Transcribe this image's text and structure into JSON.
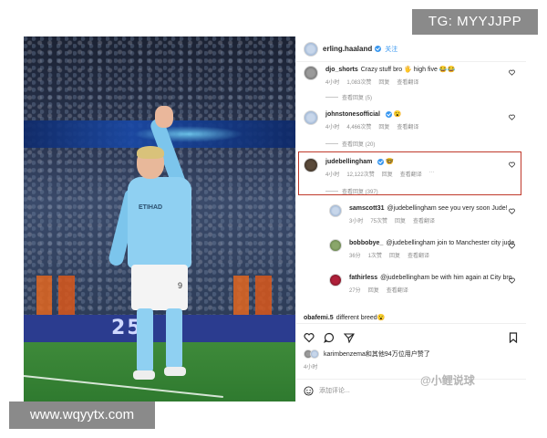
{
  "overlays": {
    "top_right": "TG: MYYJJPP",
    "bottom_left": "www.wqyytx.com",
    "watermark": "@小鲤说球"
  },
  "photo": {
    "ad_board_text": "25",
    "shirt_badge": "ETIHAD",
    "shorts_number": "9"
  },
  "post": {
    "username": "erling.haaland",
    "follow": "关注",
    "likes_text": "karimbenzema和其他94万位用户赞了",
    "time": "4小时",
    "comment_placeholder": "添加评论..."
  },
  "comments": [
    {
      "user": "djo_shorts",
      "text": "Crazy stuff bro 🖐 high five 😂😂",
      "time": "4小时",
      "likes": "1,083次赞",
      "reply": "回复",
      "translate": "查看翻译",
      "replies": "查看回复 (5)"
    },
    {
      "user": "johnstonesofficial",
      "text": "😮",
      "time": "4小时",
      "likes": "4,466次赞",
      "reply": "回复",
      "translate": "查看翻译",
      "replies": "查看回复 (20)"
    },
    {
      "user": "judebellingham",
      "text": "🤓",
      "time": "4小时",
      "likes": "12,122次赞",
      "reply": "回复",
      "translate": "查看翻译",
      "more": "···",
      "replies": "查看回复 (397)"
    }
  ],
  "replies": [
    {
      "user": "samscott31",
      "text": "@judebellingham see you very soon Jude!",
      "time": "3小时",
      "likes": "75次赞",
      "reply": "回复",
      "translate": "查看翻译"
    },
    {
      "user": "bobbobye_",
      "text": "@judebellingham join to Manchester city jude",
      "time": "36分",
      "likes": "1次赞",
      "reply": "回复",
      "translate": "查看翻译"
    },
    {
      "user": "fathirless",
      "text": "@judebellingham be with him again at City bro",
      "time": "27分",
      "likes": "",
      "reply": "回复",
      "translate": "查看翻译"
    },
    {
      "user": "obafemi.5",
      "text": "different breed😮"
    }
  ]
}
